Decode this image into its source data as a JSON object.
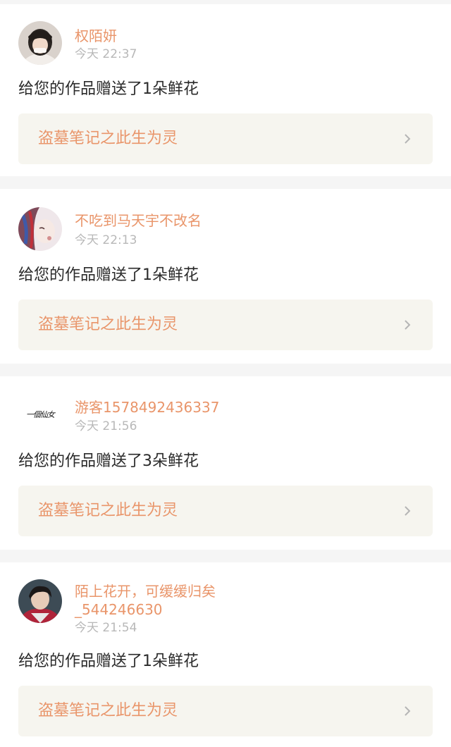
{
  "colors": {
    "accent": "#e9956a",
    "time": "#b8b8b8",
    "text": "#2a2a2a",
    "separator": "#f5f5f5",
    "work_bg": "#f6f5ef"
  },
  "notifications": [
    {
      "name_lines": [
        "权陌妍"
      ],
      "time": "今天 22:37",
      "message": "给您的作品赠送了1朵鲜花",
      "work_title": "盗墓笔记之此生为灵",
      "avatar": "girl-photo-avatar"
    },
    {
      "name_lines": [
        "不吃到马天宇不改名"
      ],
      "time": "今天 22:13",
      "message": "给您的作品赠送了1朵鲜花",
      "work_title": "盗墓笔记之此生为灵",
      "avatar": "painted-portrait-avatar"
    },
    {
      "name_lines": [
        "游客1578492436337"
      ],
      "time": "今天 21:56",
      "message": "给您的作品赠送了3朵鲜花",
      "work_title": "盗墓笔记之此生为灵",
      "avatar": "calligraphy-avatar",
      "avatar_text": "一個仙女"
    },
    {
      "name_lines": [
        "陌上花开，可缓缓归矣",
        "_544246630"
      ],
      "time": "今天 21:54",
      "message": "给您的作品赠送了1朵鲜花",
      "work_title": "盗墓笔记之此生为灵",
      "avatar": "boy-photo-avatar"
    }
  ]
}
